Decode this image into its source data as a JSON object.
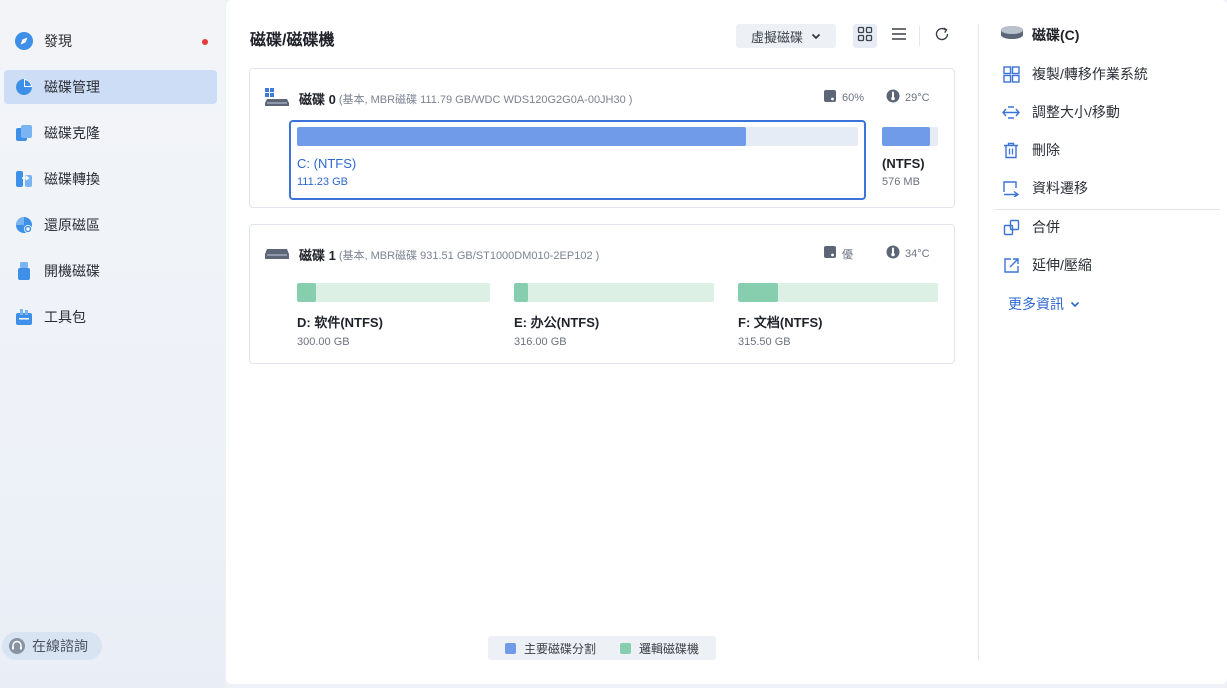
{
  "sidebar": {
    "items": [
      {
        "label": "發現",
        "icon": "compass-icon",
        "badge": true
      },
      {
        "label": "磁碟管理",
        "icon": "pie-chart-icon",
        "active": true
      },
      {
        "label": "磁碟克隆",
        "icon": "clone-icon"
      },
      {
        "label": "磁碟轉換",
        "icon": "convert-icon"
      },
      {
        "label": "還原磁區",
        "icon": "recover-icon"
      },
      {
        "label": "開機磁碟",
        "icon": "usb-icon"
      },
      {
        "label": "工具包",
        "icon": "toolbox-icon"
      }
    ],
    "consult_label": "在線諮詢"
  },
  "header": {
    "title": "磁碟/磁碟機",
    "virtual_disk_label": "虛擬磁碟"
  },
  "disks": [
    {
      "name": "磁碟 0",
      "info": "(基本, MBR磁碟 111.79 GB/WDC WDS120G2G0A-00JH30 )",
      "health": "60%",
      "temperature": "29°C",
      "partitions": [
        {
          "label": "C: (NTFS)",
          "size": "111.23 GB",
          "used_fraction": 0.8,
          "type": "primary",
          "selected": true
        },
        {
          "label": "(NTFS)",
          "size": "576 MB",
          "used_fraction": 0.85,
          "type": "primary"
        }
      ]
    },
    {
      "name": "磁碟 1",
      "info": "(基本, MBR磁碟 931.51 GB/ST1000DM010-2EP102 )",
      "health": "優",
      "temperature": "34°C",
      "partitions": [
        {
          "label": "D: 软件(NTFS)",
          "size": "300.00 GB",
          "used_fraction": 0.1,
          "type": "logical"
        },
        {
          "label": "E: 办公(NTFS)",
          "size": "316.00 GB",
          "used_fraction": 0.07,
          "type": "logical"
        },
        {
          "label": "F: 文档(NTFS)",
          "size": "315.50 GB",
          "used_fraction": 0.2,
          "type": "logical"
        }
      ]
    }
  ],
  "legend": {
    "primary_label": "主要磁碟分割",
    "logical_label": "邏輯磁碟機",
    "primary_color": "#6f9be8",
    "logical_color": "#86ceae"
  },
  "colors": {
    "primary_fill": "#6f9be8",
    "primary_track": "#e6ecf6",
    "logical_fill": "#86ceae",
    "logical_track": "#dcf0e6",
    "accent": "#3b73d9"
  },
  "right_panel": {
    "title": "磁碟(C)",
    "actions": [
      {
        "label": "複製/轉移作業系統",
        "icon": "windows-icon"
      },
      {
        "label": "調整大小/移動",
        "icon": "resize-icon"
      },
      {
        "label": "刪除",
        "icon": "trash-icon"
      },
      {
        "label": "資料遷移",
        "icon": "migrate-icon"
      },
      {
        "label": "合併",
        "icon": "merge-icon"
      },
      {
        "label": "延伸/壓縮",
        "icon": "extend-icon"
      }
    ],
    "more_label": "更多資訊"
  }
}
